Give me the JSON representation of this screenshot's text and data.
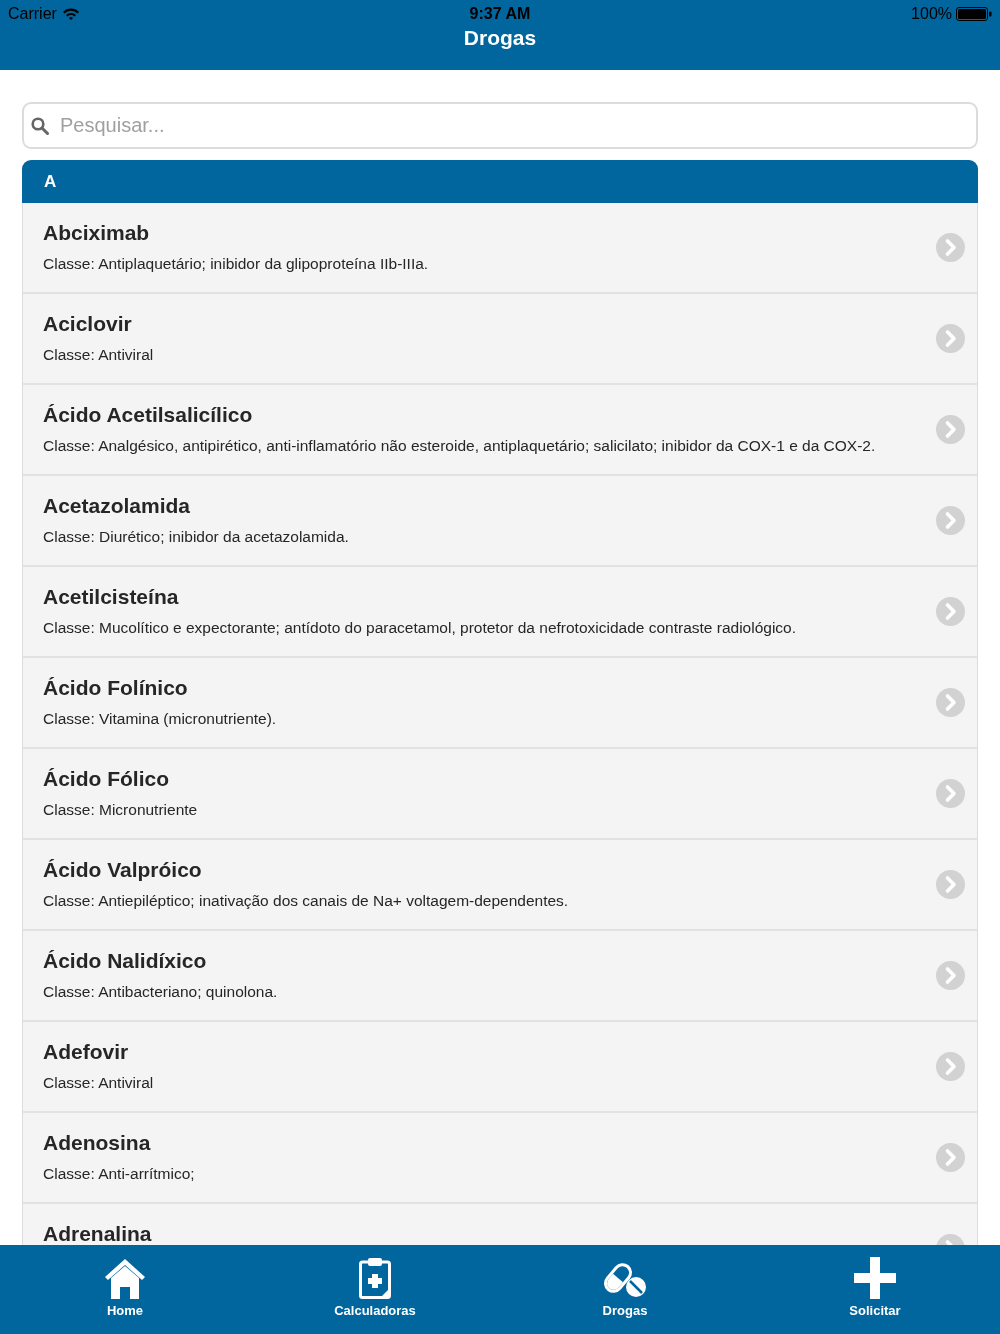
{
  "status_bar": {
    "carrier": "Carrier",
    "time": "9:37 AM",
    "battery": "100%"
  },
  "nav_bar": {
    "title": "Drogas"
  },
  "search": {
    "placeholder": "Pesquisar..."
  },
  "sections": [
    {
      "header": "A",
      "items": [
        {
          "name": "Abciximab",
          "description": "Classe: Antiplaquetário; inibidor da glipoproteína IIb-IIIa."
        },
        {
          "name": "Aciclovir",
          "description": "Classe: Antiviral"
        },
        {
          "name": "Ácido Acetilsalicílico",
          "description": "Classe: Analgésico, antipirético, anti-inflamatório não esteroide, antiplaquetário; salicilato; inibidor da COX-1 e da COX-2."
        },
        {
          "name": "Acetazolamida",
          "description": "Classe: Diurético; inibidor da acetazolamida."
        },
        {
          "name": "Acetilcisteína",
          "description": "Classe: Mucolítico e expectorante; antídoto do paracetamol, protetor da nefrotoxicidade contraste radiológico."
        },
        {
          "name": "Ácido Folínico",
          "description": "Classe: Vitamina (micronutriente)."
        },
        {
          "name": "Ácido Fólico",
          "description": "Classe: Micronutriente"
        },
        {
          "name": "Ácido Valpróico",
          "description": "Classe: Antiepiléptico; inativação dos canais de Na+ voltagem-dependentes."
        },
        {
          "name": "Ácido Nalidíxico",
          "description": "Classe: Antibacteriano; quinolona."
        },
        {
          "name": "Adefovir",
          "description": "Classe: Antiviral"
        },
        {
          "name": "Adenosina",
          "description": "Classe: Anti-arrítmico;"
        },
        {
          "name": "Adrenalina"
        }
      ]
    }
  ],
  "tab_bar": {
    "items": [
      {
        "label": "Home",
        "kind": "home"
      },
      {
        "label": "Calculadoras",
        "kind": "clipboard"
      },
      {
        "label": "Drogas",
        "kind": "pills"
      },
      {
        "label": "Solicitar",
        "kind": "plus"
      }
    ]
  }
}
